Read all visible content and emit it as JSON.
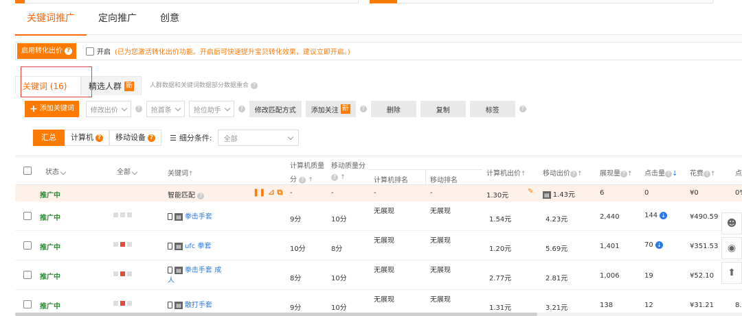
{
  "main_tabs": [
    "关键词推广",
    "定向推广",
    "创意"
  ],
  "conversion": {
    "button_label": "启用转化出价",
    "checkbox_label": "开启",
    "hint": "(已为您激活转化出价功能。开启后可快速提升宝贝转化效果，建议立即开启。)"
  },
  "sub_tabs": {
    "keywords": "关键词 (16)",
    "crowd": "精选人群",
    "crowd_badge": "新",
    "hint": "人群数据和关键词数据部分数据重合"
  },
  "toolbar": {
    "add_keyword": "添加关键词",
    "modify_bid": "修改出价",
    "grab_top": "抢首条",
    "rank_helper": "抢位助手",
    "modify_match": "修改匹配方式",
    "add_follow": "添加关注",
    "add_follow_badge": "新",
    "delete": "删除",
    "copy": "复制",
    "tag": "标签"
  },
  "filters": {
    "summary": "汇总",
    "computer": "计算机",
    "mobile": "移动设备",
    "subdivide_label": "细分条件:",
    "all": "全部"
  },
  "table": {
    "headers": {
      "status": "状态",
      "all": "全部",
      "keyword": "关键词",
      "pc_quality": "计算机质量",
      "pc_quality2": "分",
      "mobile_quality": "移动质量分",
      "pc_rank": "计算机排名",
      "mobile_rank": "移动排名",
      "pc_bid": "计算机出价",
      "mobile_bid": "移动出价",
      "impressions": "展现量",
      "clicks": "点击量",
      "cost": "花费",
      "ctr": "点"
    },
    "smart_row": {
      "status": "推广中",
      "keyword": "智能匹配",
      "pc_quality": "-",
      "mobile_quality": "-",
      "pc_rank": "-",
      "mobile_rank": "-",
      "pc_bid": "1.30元",
      "mobile_bid": "1.43元",
      "impressions": "6",
      "clicks": "0",
      "cost": "¥0",
      "ctr": "0%"
    },
    "rows": [
      {
        "status": "推广中",
        "keyword": "拳击手套",
        "keyword2": "",
        "pc_quality": "9分",
        "mobile_quality": "10分",
        "pc_rank": "无展现",
        "mobile_rank": "无展现",
        "pc_bid": "1.54元",
        "mobile_bid": "4.23元",
        "impressions": "2,440",
        "clicks": "144",
        "cost": "¥490.59",
        "ctr": "",
        "red": false
      },
      {
        "status": "推广中",
        "keyword": "ufc 拳套",
        "keyword2": "",
        "pc_quality": "10分",
        "mobile_quality": "8分",
        "pc_rank": "无展现",
        "mobile_rank": "无展现",
        "pc_bid": "1.20元",
        "mobile_bid": "5.69元",
        "impressions": "1,401",
        "clicks": "70",
        "cost": "¥351.53",
        "ctr": "",
        "red": true
      },
      {
        "status": "推广中",
        "keyword": "拳击手套 成",
        "keyword2": "人",
        "pc_quality": "8分",
        "mobile_quality": "10分",
        "pc_rank": "无展现",
        "mobile_rank": "无展现",
        "pc_bid": "2.77元",
        "mobile_bid": "2.81元",
        "impressions": "1,006",
        "clicks": "19",
        "cost": "¥52.10",
        "ctr": "",
        "red": true
      },
      {
        "status": "推广中",
        "keyword": "散打手套",
        "keyword2": "",
        "pc_quality": "9分",
        "mobile_quality": "10分",
        "pc_rank": "无展现",
        "mobile_rank": "无展现",
        "pc_bid": "1.31元",
        "mobile_bid": "3.21元",
        "impressions": "138",
        "clicks": "12",
        "cost": "¥31.21",
        "ctr": "8.",
        "red": true
      }
    ]
  },
  "colors": {
    "accent": "#ff7a00",
    "status_green": "#2d8a34",
    "link_blue": "#2b78e4"
  }
}
